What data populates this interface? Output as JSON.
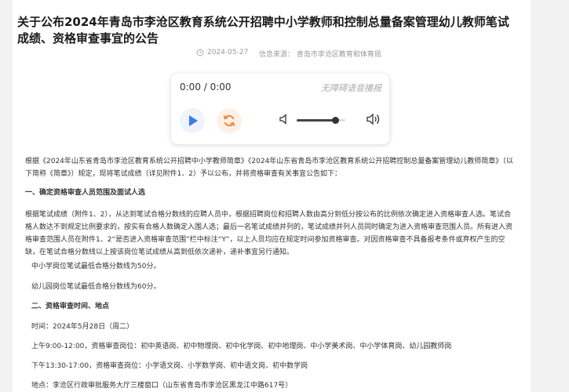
{
  "article": {
    "title": "关于公布2024年青岛市李沧区教育系统公开招聘中小学教师和控制总量备案管理幼儿教师笔试成绩、资格审查事宜的公告",
    "date": "2024-05-27",
    "source": "信息来源：  青岛市李沧区教育和体育局"
  },
  "player": {
    "time": "0:00 / 0:00",
    "brand": "无障碍语音播报",
    "volume_level": 0.8,
    "accent_color": "#3d7be8",
    "loop_color": "#f08a3c"
  },
  "content": {
    "intro": "根据《2024年山东省青岛市李沧区教育系统公开招聘中小学教师简章》《2024年山东省青岛市李沧区教育系统公开招聘控制总量备案管理幼儿教师简章》（以下简称《简章》）规定，现将笔试成绩（详见附件1、2）予以公布，并将资格审查有关事宜公告如下：",
    "section1_title": "一、确定资格审查人员范围及面试人选",
    "section1_para": "根据笔试成绩（附件1、2），从达到笔试合格分数线的应聘人员中，根据招聘岗位和招聘人数由高分到低分按公布的比例依次确定进入资格审查人选。笔试合格人数达不到规定比例要求的，按实有合格人数确定入围人选；最后一名笔试成绩并列的，笔试成绩并列人员同时确定为进入资格审查范围人员。所有进入资格审查范围人员在附件1、2“是否进入资格审查范围”栏中标注“Y”，以上人员均应在规定时间参加资格审查。对因资格审查不具备报考条件或弃权产生的空缺，在笔试合格分数线以上按该岗位笔试成绩从高到低依次递补，递补事宜另行通知。",
    "line_primary": "中小学岗位笔试最低合格分数线为50分。",
    "line_kinder": "幼儿园岗位笔试最低合格分数线为60分。",
    "section2_title": "二、资格审查时间、地点",
    "time_line": "时间：2024年5月28日（周二）",
    "am_line": "上午9:00-12:00，资格审查岗位：初中英语岗、初中物理岗、初中化学岗、初中地理岗、中小学美术岗、中小学体育岗、幼儿园教师岗",
    "pm_line": "下午13:30-17:00，资格审查岗位：小学语文岗、小学数学岗、初中语文岗、初中数学岗",
    "place_line": "地点：李沧区行政审批服务大厅三楼窗口（山东省青岛市李沧区黑龙江中路617号）"
  }
}
